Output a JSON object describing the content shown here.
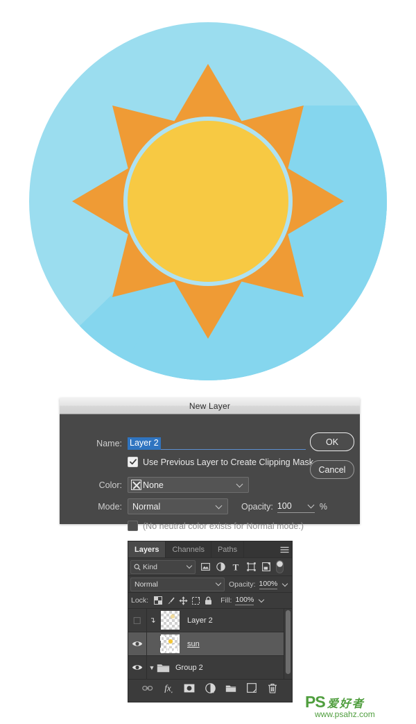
{
  "artwork": {
    "name": "flat-sun-icon",
    "colors": {
      "background_circle": "#9BDDEF",
      "long_shadow": "#85D6EE",
      "ray_orange": "#EF9B35",
      "core_yellow": "#F7C943",
      "core_ring": "#AEE2F2",
      "canvas": "#FFFFFF"
    },
    "ray_count": 8
  },
  "dialog": {
    "title": "New Layer",
    "name_label": "Name:",
    "name_value": "Layer 2",
    "clipping_checkbox": {
      "label": "Use Previous Layer to Create Clipping Mask",
      "checked": true
    },
    "color_label": "Color:",
    "color_value": "None",
    "mode_label": "Mode:",
    "mode_value": "Normal",
    "opacity_label": "Opacity:",
    "opacity_value": "100",
    "opacity_percent": "%",
    "neutral_checkbox": {
      "label": "(No neutral color exists for Normal mode.)",
      "checked": false
    },
    "ok_label": "OK",
    "cancel_label": "Cancel",
    "accent_selection": "#2F74C0"
  },
  "layers_panel": {
    "tabs": [
      {
        "label": "Layers",
        "active": true
      },
      {
        "label": "Channels",
        "active": false
      },
      {
        "label": "Paths",
        "active": false
      }
    ],
    "menu_icon": "hamburger-menu-icon",
    "filter": {
      "search_icon": "magnifier-icon",
      "kind_label": "Kind",
      "icons": [
        "pixel-layer-filter-icon",
        "adjustment-layer-filter-icon",
        "type-layer-filter-icon",
        "shape-layer-filter-icon",
        "smart-object-filter-icon"
      ],
      "toggle_icon": "filter-toggle-switch"
    },
    "blend": {
      "mode_value": "Normal",
      "opacity_label": "Opacity:",
      "opacity_value": "100%"
    },
    "lock": {
      "label": "Lock:",
      "icons": [
        "lock-transparent-pixels-icon",
        "lock-image-pixels-icon",
        "lock-position-icon",
        "lock-artboard-nesting-icon",
        "lock-all-icon"
      ],
      "fill_label": "Fill:",
      "fill_value": "100%"
    },
    "rows": [
      {
        "name": "Layer 2",
        "visible": false,
        "selected": false,
        "clipped": true,
        "type": "pixel",
        "underlined": false
      },
      {
        "name": "sun",
        "visible": true,
        "selected": true,
        "clipped": false,
        "type": "pixel",
        "underlined": true
      },
      {
        "name": "Group 2",
        "visible": true,
        "selected": false,
        "clipped": false,
        "type": "group",
        "underlined": false
      }
    ],
    "footer_icons": [
      "link-layers-icon",
      "layer-style-fx-icon",
      "add-layer-mask-icon",
      "new-adjustment-layer-icon",
      "new-group-icon",
      "new-layer-icon",
      "delete-layer-icon"
    ]
  },
  "watermark": {
    "brand": "PS",
    "brand_cn": "爱好者",
    "url": "www.psahz.com",
    "color": "#4F9E3E"
  }
}
